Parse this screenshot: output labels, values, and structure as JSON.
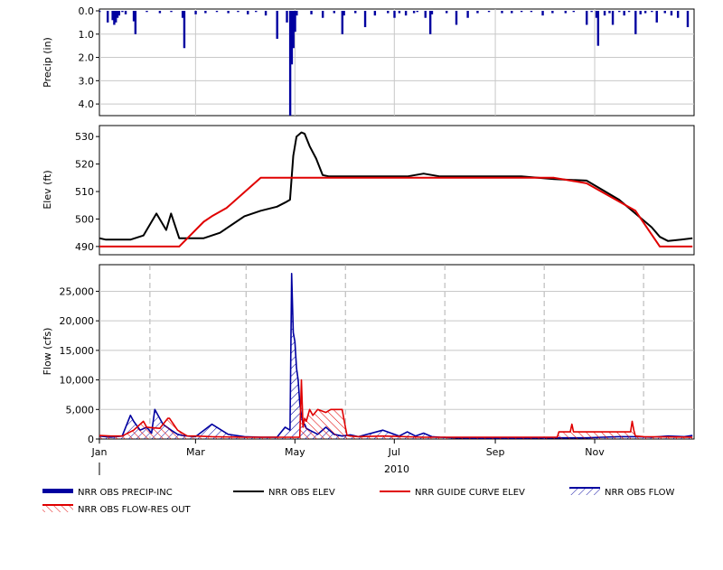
{
  "chart_data": [
    {
      "type": "bar",
      "panel": "precip",
      "ylabel": "Precip (in)",
      "ylim": [
        4.5,
        0.0
      ],
      "inverted": true,
      "yticks": [
        "0.0",
        "1.0",
        "2.0",
        "3.0",
        "4.0"
      ],
      "ytick_values": [
        0,
        1,
        2,
        3,
        4
      ],
      "grid": true,
      "series": [
        {
          "name": "NRR OBS PRECIP-INC",
          "color": "#0000a0",
          "x_days": [
            1,
            6,
            9,
            10,
            11,
            12,
            13,
            15,
            17,
            22,
            23,
            30,
            38,
            45,
            52,
            53,
            60,
            66,
            73,
            80,
            86,
            92,
            97,
            103,
            110,
            116,
            118,
            119,
            120,
            121,
            122,
            131,
            138,
            145,
            150,
            151,
            158,
            164,
            170,
            178,
            182,
            185,
            189,
            194,
            196,
            201,
            204,
            205,
            214,
            220,
            227,
            233,
            240,
            248,
            254,
            260,
            266,
            273,
            279,
            287,
            292,
            300,
            303,
            306,
            307,
            311,
            314,
            316,
            320,
            323,
            326,
            330,
            333,
            336,
            340,
            343,
            348,
            352,
            356,
            362
          ],
          "values": [
            0.05,
            0.5,
            0.4,
            0.6,
            0.5,
            0.3,
            0.2,
            0.05,
            0.15,
            0.45,
            1.0,
            0.05,
            0.1,
            0.05,
            0.3,
            1.6,
            0.15,
            0.1,
            0.05,
            0.1,
            0.05,
            0.15,
            0.05,
            0.2,
            1.2,
            0.5,
            4.5,
            2.3,
            1.6,
            0.9,
            0.2,
            0.15,
            0.3,
            0.1,
            1.0,
            0.2,
            0.1,
            0.7,
            0.2,
            0.1,
            0.3,
            0.1,
            0.2,
            0.1,
            0.05,
            0.3,
            1.0,
            0.15,
            0.1,
            0.6,
            0.3,
            0.1,
            0.05,
            0.1,
            0.1,
            0.05,
            0.05,
            0.2,
            0.1,
            0.1,
            0.05,
            0.6,
            0.05,
            0.3,
            1.5,
            0.2,
            0.1,
            0.6,
            0.05,
            0.2,
            0.05,
            1.0,
            0.15,
            0.1,
            0.05,
            0.5,
            0.1,
            0.2,
            0.3,
            0.7
          ]
        }
      ]
    },
    {
      "type": "line",
      "panel": "elev",
      "ylabel": "Elev (ft)",
      "ylim": [
        487,
        534
      ],
      "yticks": [
        "490",
        "500",
        "510",
        "520",
        "530"
      ],
      "ytick_values": [
        490,
        500,
        510,
        520,
        530
      ],
      "grid": false,
      "series": [
        {
          "name": "NRR OBS ELEV",
          "color": "#000000",
          "x_days": [
            1,
            5,
            10,
            20,
            28,
            36,
            42,
            45,
            50,
            55,
            60,
            65,
            75,
            80,
            90,
            100,
            110,
            115,
            118,
            120,
            122,
            125,
            127,
            130,
            134,
            138,
            142,
            146,
            150,
            155,
            160,
            170,
            190,
            200,
            210,
            220,
            240,
            260,
            280,
            300,
            320,
            330,
            340,
            345,
            350,
            358,
            365
          ],
          "values": [
            493,
            492.5,
            492.5,
            492.5,
            494,
            502,
            496,
            502,
            493,
            493,
            493,
            493,
            495,
            497,
            501,
            503,
            504.5,
            506,
            507,
            523,
            530,
            531.5,
            531,
            526.5,
            522,
            516,
            515.5,
            515.5,
            515.5,
            515.5,
            515.5,
            515.5,
            515.5,
            516.5,
            515.5,
            515.5,
            515.5,
            515.5,
            514.5,
            514,
            507,
            502,
            497,
            493.5,
            492,
            492.5,
            493
          ]
        },
        {
          "name": "NRR GUIDE CURVE ELEV",
          "color": "#e00000",
          "x_days": [
            1,
            50,
            65,
            70,
            79,
            100,
            115,
            280,
            300,
            330,
            345,
            365
          ],
          "values": [
            490,
            490,
            499,
            501,
            504,
            515,
            515,
            515,
            513,
            503,
            490,
            490
          ]
        }
      ]
    },
    {
      "type": "area",
      "panel": "flow",
      "ylabel": "Flow (cfs)",
      "ylim": [
        0,
        29500
      ],
      "yticks": [
        "0",
        "5,000",
        "10,000",
        "15,000",
        "20,000",
        "25,000"
      ],
      "ytick_values": [
        0,
        5000,
        10000,
        15000,
        20000,
        25000
      ],
      "grid": true,
      "xticks": [
        "Jan",
        "Mar",
        "May",
        "Jul",
        "Sep",
        "Nov"
      ],
      "xtick_days": [
        1,
        60,
        121,
        182,
        244,
        305
      ],
      "xlabel": "2010",
      "series": [
        {
          "name": "NRR OBS FLOW",
          "color": "#0000a0",
          "x_days": [
            1,
            8,
            15,
            20,
            22,
            26,
            30,
            33,
            35,
            40,
            45,
            49,
            52,
            55,
            60,
            70,
            80,
            90,
            100,
            110,
            115,
            118,
            119,
            120,
            121,
            122,
            123,
            124,
            125,
            126,
            127,
            128,
            130,
            135,
            140,
            145,
            150,
            155,
            160,
            175,
            185,
            190,
            195,
            200,
            205,
            210,
            220,
            230,
            240,
            260,
            280,
            300,
            310,
            320,
            330,
            340,
            350,
            360,
            365
          ],
          "values": [
            500,
            300,
            500,
            4000,
            3000,
            1500,
            2000,
            1000,
            5000,
            2500,
            1500,
            800,
            600,
            500,
            400,
            2500,
            800,
            400,
            300,
            300,
            2000,
            1500,
            28000,
            18000,
            16500,
            12000,
            10000,
            6000,
            4000,
            2500,
            2500,
            1800,
            1500,
            800,
            2000,
            800,
            500,
            700,
            400,
            1500,
            500,
            1200,
            500,
            1000,
            400,
            300,
            200,
            150,
            150,
            150,
            200,
            200,
            300,
            400,
            400,
            300,
            500,
            400,
            600
          ]
        },
        {
          "name": "NRR OBS FLOW-RES OUT",
          "color": "#e00000",
          "x_days": [
            1,
            8,
            15,
            22,
            28,
            30,
            38,
            43,
            44,
            49,
            52,
            55,
            60,
            70,
            90,
            110,
            118,
            124,
            125,
            126,
            127,
            128,
            130,
            132,
            135,
            140,
            143,
            145,
            150,
            152,
            153,
            155,
            160,
            175,
            200,
            240,
            282,
            283,
            290,
            291,
            292,
            320,
            327,
            328,
            329,
            330,
            335,
            365
          ],
          "values": [
            600,
            500,
            500,
            1500,
            3000,
            2000,
            1800,
            3500,
            3500,
            1500,
            1000,
            500,
            500,
            400,
            300,
            300,
            300,
            300,
            10000,
            2000,
            3500,
            3000,
            5000,
            4000,
            5000,
            4500,
            5000,
            5000,
            5000,
            2000,
            600,
            500,
            400,
            500,
            300,
            300,
            300,
            1200,
            1200,
            2500,
            1200,
            1200,
            1200,
            3000,
            1500,
            500,
            400,
            300
          ]
        }
      ]
    }
  ],
  "legend": [
    {
      "label": "NRR OBS PRECIP-INC",
      "style": "thick-bar",
      "color": "#0000a0"
    },
    {
      "label": "NRR OBS ELEV",
      "style": "line",
      "color": "#000000"
    },
    {
      "label": "NRR GUIDE CURVE ELEV",
      "style": "line",
      "color": "#e00000"
    },
    {
      "label": "NRR OBS FLOW",
      "style": "hatch",
      "color": "#0000a0"
    },
    {
      "label": "NRR OBS FLOW-RES OUT",
      "style": "hatch",
      "color": "#e00000"
    }
  ]
}
